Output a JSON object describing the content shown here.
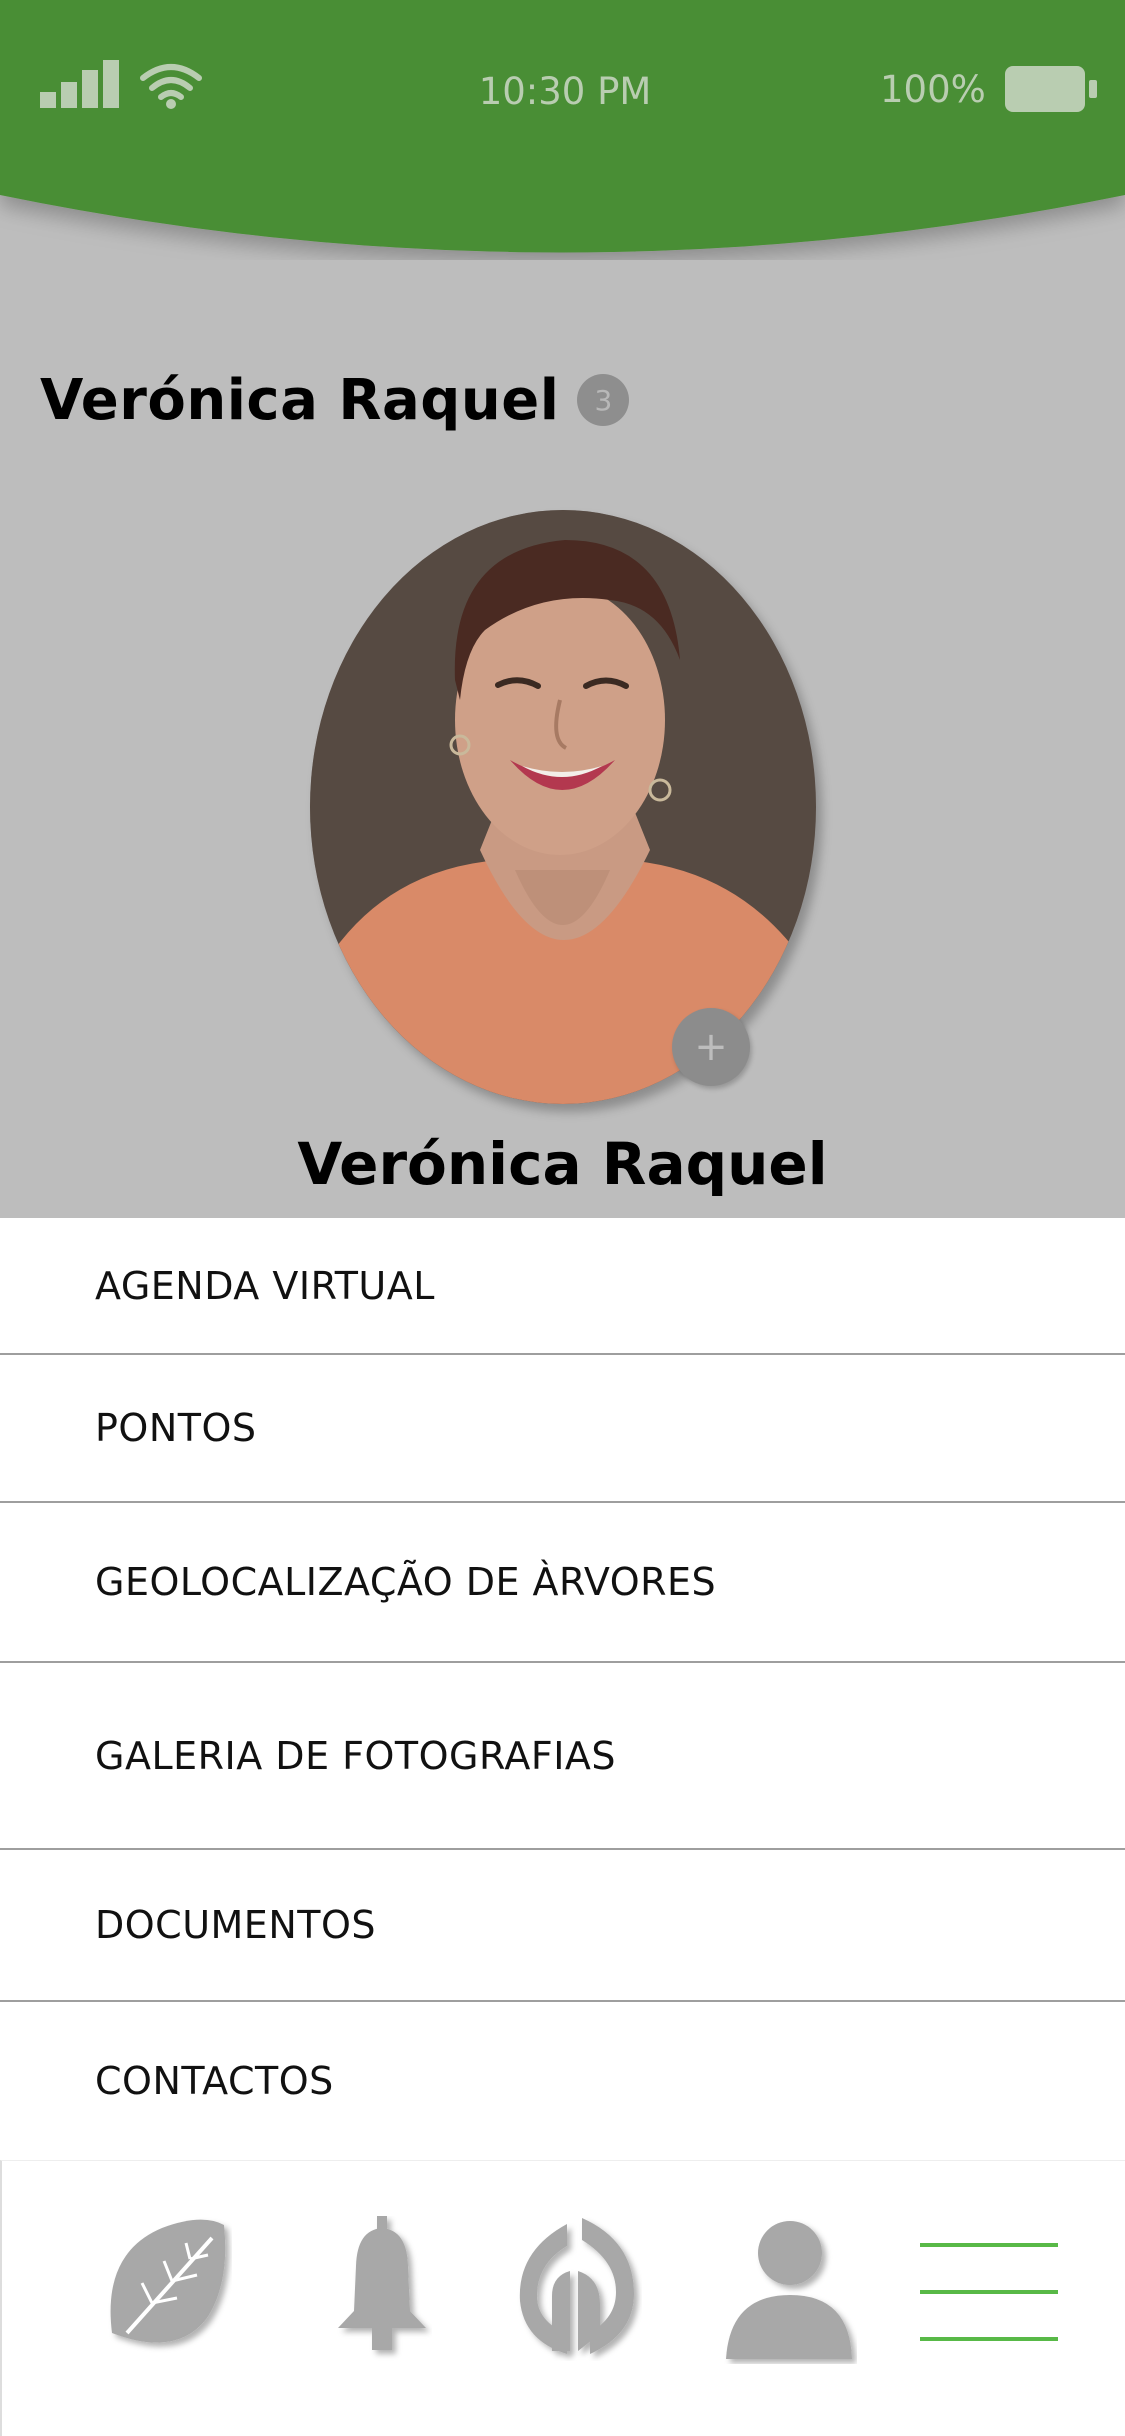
{
  "status_bar": {
    "time": "10:30 PM",
    "battery_percent": "100%",
    "signal_icon": "signal-icon",
    "wifi_icon": "wifi-icon",
    "battery_icon": "battery-icon"
  },
  "profile": {
    "title": "Verónica Raquel",
    "badge_count": "3",
    "name": "Verónica Raquel",
    "add_button_symbol": "+"
  },
  "menu": {
    "items": [
      {
        "label": "AGENDA VIRTUAL"
      },
      {
        "label": "PONTOS"
      },
      {
        "label": "GEOLOCALIZAÇÃO DE ÀRVORES"
      },
      {
        "label": "GALERIA DE FOTOGRAFIAS"
      },
      {
        "label": "DOCUMENTOS"
      },
      {
        "label": "CONTACTOS"
      }
    ]
  },
  "bottom_nav": {
    "items": [
      {
        "icon": "leaf-icon"
      },
      {
        "icon": "bell-icon"
      },
      {
        "icon": "app-logo-icon"
      },
      {
        "icon": "user-icon"
      },
      {
        "icon": "hamburger-menu-icon"
      }
    ]
  },
  "colors": {
    "header_green": "#4a8e36",
    "overlay_gray": "#bdbdbd",
    "menu_accent_green": "#58b947",
    "icon_gray": "#a8a8a8"
  }
}
